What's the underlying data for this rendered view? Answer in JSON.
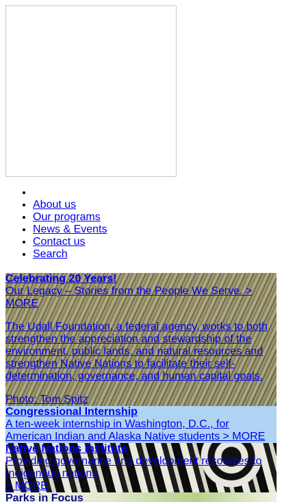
{
  "nav": {
    "items": [
      {
        "label": ""
      },
      {
        "label": "About us"
      },
      {
        "label": "Our programs"
      },
      {
        "label": "News & Events"
      },
      {
        "label": "Contact us"
      },
      {
        "label": "Search"
      }
    ]
  },
  "promos": {
    "celebrate": {
      "title": "Celebrating 20 Years!",
      "link": "Our Legacy – Stories from the People We Serve. > MORE",
      "body": "The Udall Foundation, a federal agency, works to both strengthen the appreciation and stewardship of the environment, public lands, and natural resources and strengthen Native Nations to facilitate their self-determination, governance, and human capital goals.",
      "photo": "Photo: Tom Spitz"
    },
    "internship": {
      "title": "Congressional Internship",
      "text": "A ten-week internship in Washington, D.C., for American Indian and Alaska Native students > MORE"
    },
    "nni": {
      "title": "Native Nations Institute",
      "text": "Providing governance and development resources to Indigenous nations",
      "more": "> MORE"
    },
    "parks": {
      "title": "Parks in Focus"
    }
  }
}
